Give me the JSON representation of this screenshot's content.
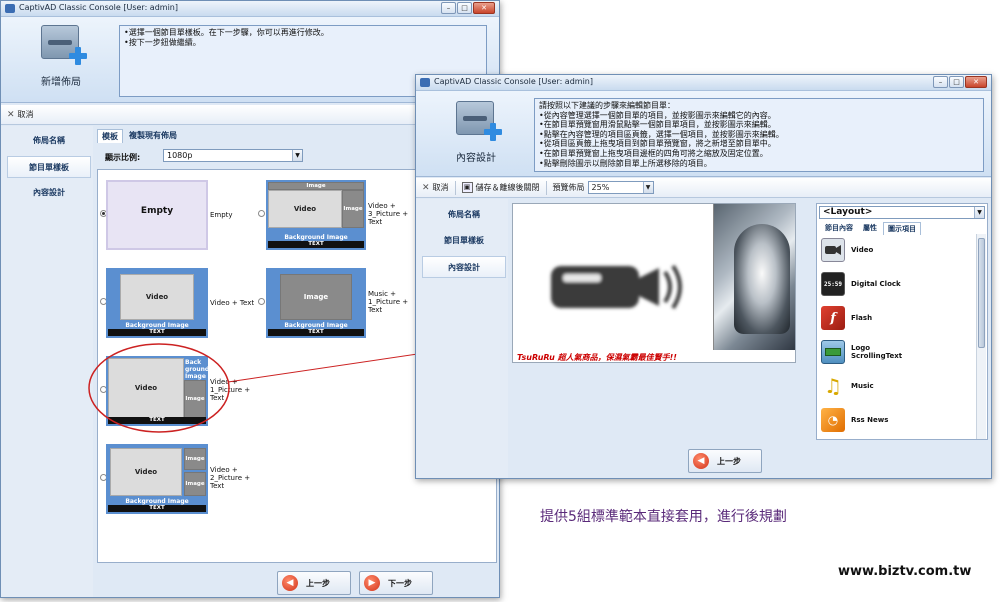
{
  "win1": {
    "title": "CaptivAD Classic Console [User: admin]",
    "big_label": "新增佈局",
    "instructions": [
      "•選擇一個節目單樣板。在下一步驟，你可以再進行修改。",
      "•按下一步鈕做繼續。"
    ],
    "cancel_label": "取消",
    "nav": [
      "佈局名稱",
      "節目單樣板",
      "內容設計"
    ],
    "tabs": [
      "模板",
      "複製現有佈局"
    ],
    "ratio_label": "顯示比例:",
    "ratio_value": "1080p",
    "templates": [
      {
        "main": "Empty",
        "label": "Empty"
      },
      {
        "main": "Video",
        "top": "Image",
        "right": "Image",
        "bg": "Background Image",
        "txt": "TEXT",
        "label": [
          "Video +",
          "3_Picture +",
          "Text"
        ]
      },
      {
        "main": "Video",
        "bg": "Background Image",
        "txt": "TEXT",
        "label": "Video + Text"
      },
      {
        "main": "Image",
        "bg": "Background Image",
        "txt": "TEXT",
        "label": [
          "Music +",
          "1_Picture +",
          "Text"
        ]
      },
      {
        "main": "Video",
        "bg": "Back ground Image",
        "side": "Image",
        "txt": "TEXT",
        "label": [
          "Video +",
          "1_Picture +",
          "Text"
        ]
      },
      {
        "main": "Video",
        "side1": "Image",
        "side2": "Image",
        "bg": "Background Image",
        "txt": "TEXT",
        "label": [
          "Video +",
          "2_Picture +",
          "Text"
        ]
      }
    ],
    "back_label": "上一步",
    "next_label": "下一步"
  },
  "win2": {
    "title": "CaptivAD Classic Console [User: admin]",
    "big_label": "內容設計",
    "instructions": [
      "請按照以下建議的步驟來編輯節目單：",
      "•從內容管理選擇一個節目單的項目，並按影圖示來編輯它的內容。",
      "•在節目單預覽窗用滑鼠點擊一個節目單項目，並按影圖示來編輯。",
      "•點擊在內容管理的項目區頁籤，選擇一個項目，並按影圖示來編輯。",
      "•從項目區頁籤上拖曳項目到節目單預覽窗，將之新增至節目單中。",
      "•在節目單預覽窗上拖曳項目邊框的四角可將之縮放及固定位置。",
      "•點擊刪除圖示以刪除節目單上所選移除的項目。"
    ],
    "cancel_label": "取消",
    "save_label": "儲存＆離線後關閉",
    "zoom_label": "預覽佈局",
    "zoom_value": "25%",
    "nav": [
      "佈局名稱",
      "節目單樣板",
      "內容設計"
    ],
    "ticker": "TsuRuRu 超人氣商品，保濕氣霸最佳賢手!!",
    "layout_select": "<Layout>",
    "prop_tabs": [
      "節目內容",
      "屬性",
      "圖示項目"
    ],
    "items": [
      {
        "name": "Video",
        "icon": "video-camera-icon"
      },
      {
        "name": "Digital Clock",
        "icon": "digital-clock-icon",
        "glyph": "25:59"
      },
      {
        "name": "Flash",
        "icon": "flash-icon"
      },
      {
        "name": [
          "Logo",
          "ScrollingText"
        ],
        "icon": "logo-icon"
      },
      {
        "name": "Music",
        "icon": "music-note-icon"
      },
      {
        "name": "Rss News",
        "icon": "rss-icon"
      }
    ],
    "back_label": "上一步"
  },
  "caption": "提供5組標準範本直接套用，進行後規劃",
  "site": "www.biztv.com.tw",
  "colors": {
    "accent": "#2f8be0",
    "highlight_ring": "#cc2222",
    "ticker": "#cc0000"
  }
}
